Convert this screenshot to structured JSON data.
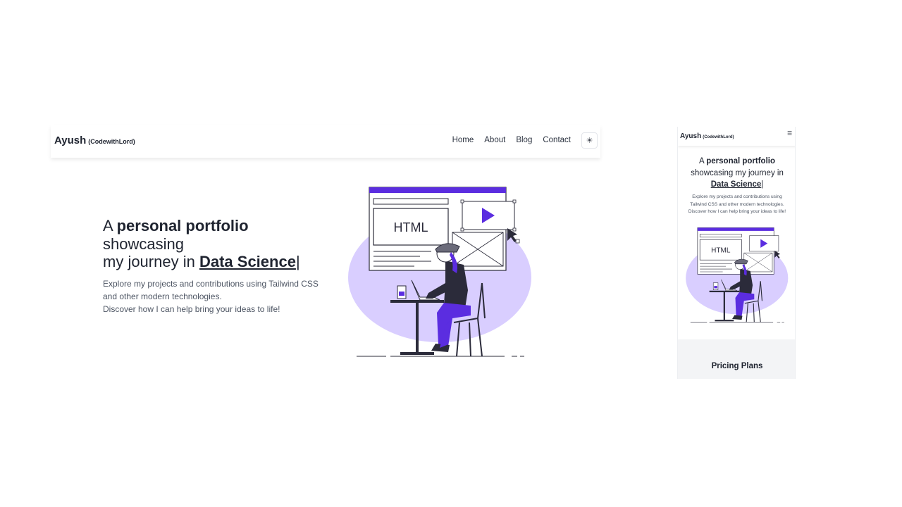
{
  "brand": {
    "name": "Ayush",
    "tag": "(CodewithLord)"
  },
  "nav": {
    "links": [
      "Home",
      "About",
      "Blog",
      "Contact"
    ],
    "theme_icon": "sun-icon"
  },
  "hero": {
    "title_prefix": "A",
    "title_strong": "personal portfolio",
    "title_line2": "showcasing",
    "title_line3_prefix": "my journey in",
    "highlight": "Data Science",
    "cursor": "|",
    "desc_line1": "Explore my projects and contributions using Tailwind CSS",
    "desc_line2": "and other modern technologies.",
    "desc_line3": "Discover how I can help bring your ideas to life!",
    "mobile_desc_line1": "Explore my projects and contributions using",
    "mobile_desc_line2": "Tailwind CSS and other modern technologies.",
    "mobile_desc_line3": "Discover how I can help bring your ideas to life!"
  },
  "illustration": {
    "code_label": "HTML",
    "accent": "#5b2de0",
    "blob": "#d9ceff"
  },
  "mobile": {
    "menu_icon": "menu-icon",
    "pricing_title": "Pricing Plans"
  }
}
